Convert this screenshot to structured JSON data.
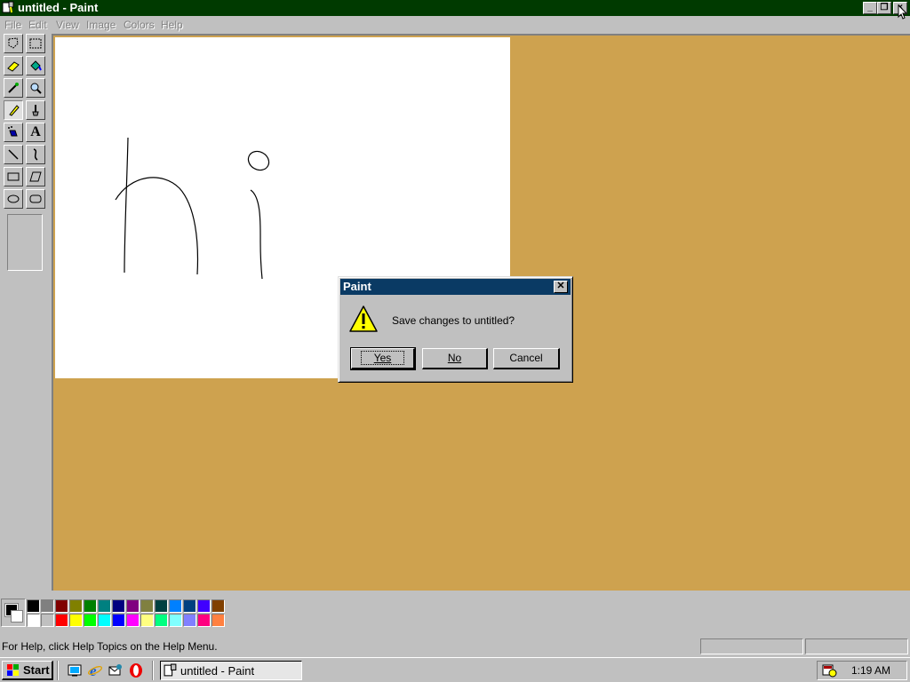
{
  "window": {
    "title": "untitled - Paint",
    "caption_buttons": {
      "minimize": "_",
      "restore": "❐",
      "close": "×"
    },
    "titlebar_color": "#003a00"
  },
  "menu": [
    {
      "label": "File"
    },
    {
      "label": "Edit"
    },
    {
      "label": "View"
    },
    {
      "label": "Image"
    },
    {
      "label": "Colors"
    },
    {
      "label": "Help"
    }
  ],
  "tools": [
    {
      "name": "free-form-select-icon"
    },
    {
      "name": "select-icon"
    },
    {
      "name": "eraser-icon"
    },
    {
      "name": "fill-with-color-icon"
    },
    {
      "name": "pick-color-icon"
    },
    {
      "name": "magnifier-icon"
    },
    {
      "name": "pencil-icon",
      "selected": true
    },
    {
      "name": "brush-icon"
    },
    {
      "name": "airbrush-icon"
    },
    {
      "name": "text-icon",
      "glyph": "A"
    },
    {
      "name": "line-icon"
    },
    {
      "name": "curve-icon"
    },
    {
      "name": "rectangle-icon"
    },
    {
      "name": "polygon-icon"
    },
    {
      "name": "ellipse-icon"
    },
    {
      "name": "rounded-rectangle-icon"
    }
  ],
  "palette": {
    "foreground": "#000000",
    "background": "#ffffff",
    "row1": [
      "#000000",
      "#808080",
      "#800000",
      "#808000",
      "#008000",
      "#008080",
      "#000080",
      "#800080",
      "#808040",
      "#004040",
      "#0080ff",
      "#004080",
      "#4000ff",
      "#804000"
    ],
    "row2": [
      "#ffffff",
      "#c0c0c0",
      "#ff0000",
      "#ffff00",
      "#00ff00",
      "#00ffff",
      "#0000ff",
      "#ff00ff",
      "#ffff80",
      "#00ff80",
      "#80ffff",
      "#8080ff",
      "#ff0080",
      "#ff8040"
    ]
  },
  "workspace_color": "#cea24f",
  "status": {
    "help_text": "For Help, click Help Topics on the Help Menu."
  },
  "dialog": {
    "title": "Paint",
    "message": "Save changes to untitled?",
    "icon": "warning-icon",
    "buttons": {
      "yes": "Yes",
      "no": "No",
      "cancel": "Cancel"
    },
    "title_color": "#0a3a64"
  },
  "taskbar": {
    "start_label": "Start",
    "quick_launch": [
      "show-desktop-icon",
      "internet-explorer-icon",
      "outlook-express-icon",
      "opera-icon"
    ],
    "task_label": "untitled - Paint",
    "clock": "1:19 AM"
  }
}
